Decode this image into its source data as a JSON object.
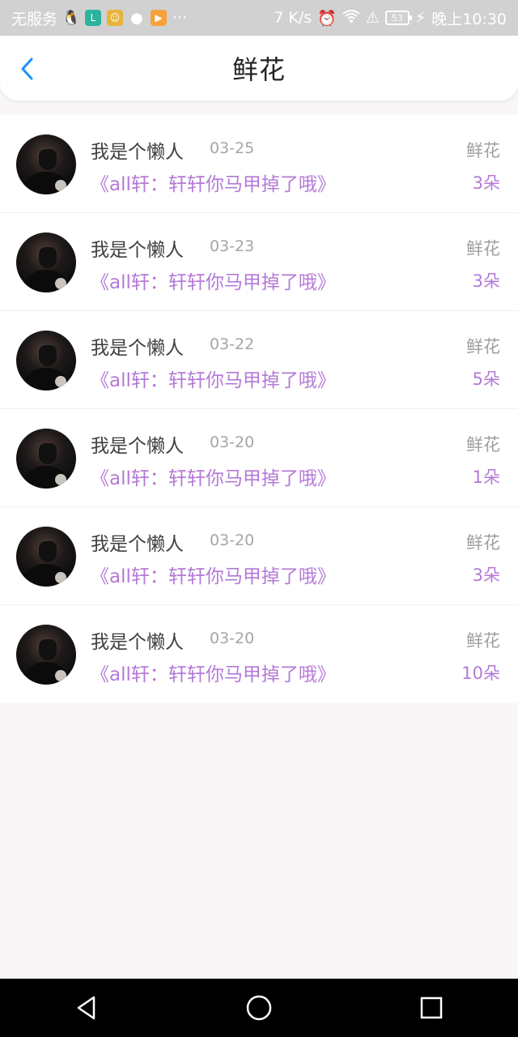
{
  "status_bar": {
    "carrier": "无服务",
    "notification_icons": [
      "qq-icon",
      "app-icon-green",
      "app-icon-yellow",
      "wechat-icon",
      "video-app-icon"
    ],
    "more": "···",
    "speed": "7 K/s",
    "battery": "53",
    "time": "晚上10:30"
  },
  "header": {
    "title": "鲜花",
    "accent_color": "#1e90ff"
  },
  "list": {
    "items": [
      {
        "name": "我是个懒人",
        "date": "03-25",
        "label": "鲜花",
        "book": "《all轩：轩轩你马甲掉了哦》",
        "count": "3朵"
      },
      {
        "name": "我是个懒人",
        "date": "03-23",
        "label": "鲜花",
        "book": "《all轩：轩轩你马甲掉了哦》",
        "count": "3朵"
      },
      {
        "name": "我是个懒人",
        "date": "03-22",
        "label": "鲜花",
        "book": "《all轩：轩轩你马甲掉了哦》",
        "count": "5朵"
      },
      {
        "name": "我是个懒人",
        "date": "03-20",
        "label": "鲜花",
        "book": "《all轩：轩轩你马甲掉了哦》",
        "count": "1朵"
      },
      {
        "name": "我是个懒人",
        "date": "03-20",
        "label": "鲜花",
        "book": "《all轩：轩轩你马甲掉了哦》",
        "count": "3朵"
      },
      {
        "name": "我是个懒人",
        "date": "03-20",
        "label": "鲜花",
        "book": "《all轩：轩轩你马甲掉了哦》",
        "count": "10朵"
      }
    ],
    "highlight_color": "#b47ad6"
  },
  "nav": {
    "icons": [
      "back-triangle-icon",
      "home-circle-icon",
      "recents-square-icon"
    ]
  }
}
